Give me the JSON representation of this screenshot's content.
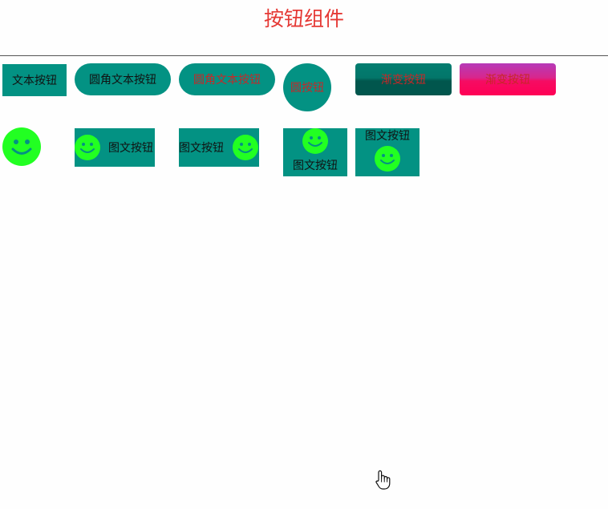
{
  "header": {
    "title": "按钮组件"
  },
  "row1": {
    "text_button": "文本按钮",
    "rounded_button": "圆角文本按钮",
    "rounded_red_button": "圆角文本按钮",
    "circle_button": "圆按钮",
    "gradient_green_button": "渐变按钮",
    "gradient_pink_button": "渐变按钮"
  },
  "row2": {
    "icon_left_label": "图文按钮",
    "icon_right_label": "图文按钮",
    "icon_top_label": "图文按钮",
    "icon_bottom_label": "图文按钮"
  },
  "colors": {
    "title": "#e53935",
    "button_bg": "#039283",
    "smile_icon": "#22ff22",
    "gradient_green": [
      "#037a6e",
      "#01564d"
    ],
    "gradient_pink": [
      "#b63ab8",
      "#ff0055"
    ]
  },
  "icons": [
    "smiley-icon",
    "hand-pointer-icon"
  ]
}
